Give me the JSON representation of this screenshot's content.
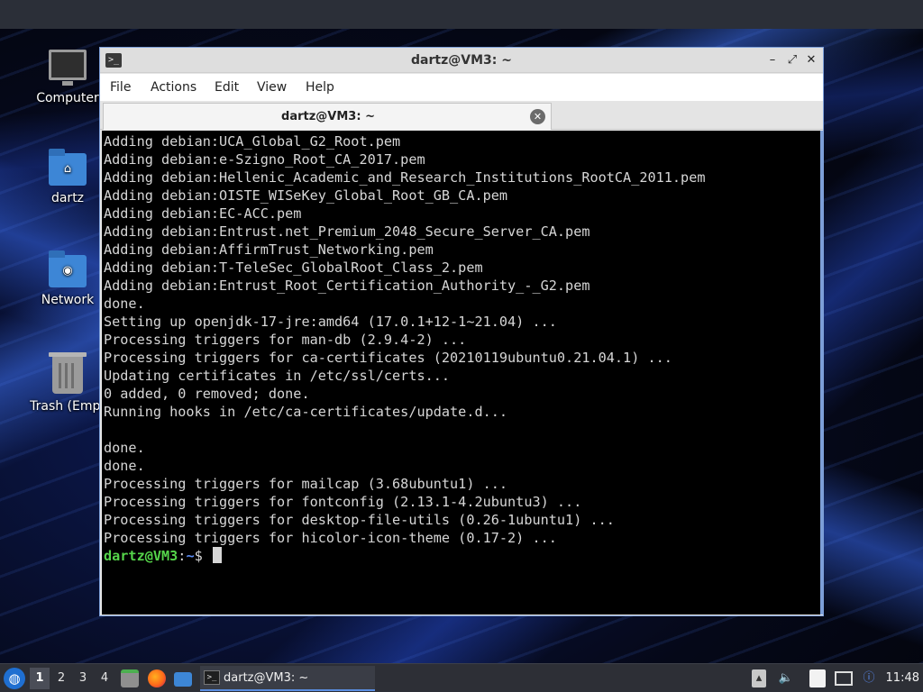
{
  "desktop": {
    "icons": [
      {
        "label": "Computer",
        "icon": "computer-icon"
      },
      {
        "label": "dartz",
        "icon": "home-folder-icon"
      },
      {
        "label": "Network",
        "icon": "network-folder-icon"
      },
      {
        "label": "Trash (Empt",
        "icon": "trash-icon"
      }
    ]
  },
  "window": {
    "title": "dartz@VM3: ~",
    "menu": [
      "File",
      "Actions",
      "Edit",
      "View",
      "Help"
    ],
    "tab": {
      "label": "dartz@VM3: ~"
    },
    "terminal": {
      "lines": [
        "Adding debian:UCA_Global_G2_Root.pem",
        "Adding debian:e-Szigno_Root_CA_2017.pem",
        "Adding debian:Hellenic_Academic_and_Research_Institutions_RootCA_2011.pem",
        "Adding debian:OISTE_WISeKey_Global_Root_GB_CA.pem",
        "Adding debian:EC-ACC.pem",
        "Adding debian:Entrust.net_Premium_2048_Secure_Server_CA.pem",
        "Adding debian:AffirmTrust_Networking.pem",
        "Adding debian:T-TeleSec_GlobalRoot_Class_2.pem",
        "Adding debian:Entrust_Root_Certification_Authority_-_G2.pem",
        "done.",
        "Setting up openjdk-17-jre:amd64 (17.0.1+12-1~21.04) ...",
        "Processing triggers for man-db (2.9.4-2) ...",
        "Processing triggers for ca-certificates (20210119ubuntu0.21.04.1) ...",
        "Updating certificates in /etc/ssl/certs...",
        "0 added, 0 removed; done.",
        "Running hooks in /etc/ca-certificates/update.d...",
        "",
        "done.",
        "done.",
        "Processing triggers for mailcap (3.68ubuntu1) ...",
        "Processing triggers for fontconfig (2.13.1-4.2ubuntu3) ...",
        "Processing triggers for desktop-file-utils (0.26-1ubuntu1) ...",
        "Processing triggers for hicolor-icon-theme (0.17-2) ..."
      ],
      "prompt": {
        "user": "dartz@VM3",
        "sep": ":",
        "path": "~",
        "symbol": "$ "
      }
    }
  },
  "taskbar": {
    "workspaces": [
      "1",
      "2",
      "3",
      "4"
    ],
    "active_workspace": "1",
    "task": {
      "label": "dartz@VM3: ~"
    },
    "clock": "11:48"
  },
  "colors": {
    "prompt_user": "#55d44a",
    "prompt_path": "#5b8cf5",
    "window_border": "#7d9fd8"
  }
}
